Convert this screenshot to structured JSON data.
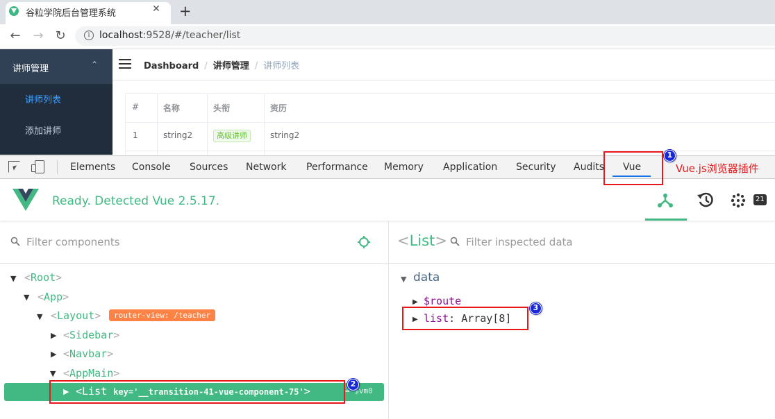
{
  "browser": {
    "tab_title": "谷粒学院后台管理系统",
    "tab_close": "✕",
    "new_tab": "+",
    "back": "←",
    "forward": "→",
    "reload": "↻",
    "url_host": "localhost",
    "url_rest": ":9528/#/teacher/list",
    "info_glyph": "i"
  },
  "app": {
    "sidebar": {
      "group_label": "讲师管理",
      "chevron": "⌃",
      "items": [
        {
          "label": "讲师列表",
          "active": true
        },
        {
          "label": "添加讲师",
          "active": false
        }
      ]
    },
    "breadcrumb": [
      "Dashboard",
      "讲师管理",
      "讲师列表"
    ],
    "breadcrumb_sep": "/",
    "table": {
      "headers": [
        "#",
        "名称",
        "头衔",
        "资历"
      ],
      "rows": [
        {
          "index": "1",
          "name": "string2",
          "title": "高级讲师",
          "resume": "string2"
        }
      ]
    }
  },
  "devtools": {
    "tabs": [
      "Elements",
      "Console",
      "Sources",
      "Network",
      "Performance",
      "Memory",
      "Application",
      "Security",
      "Audits",
      "Vue"
    ],
    "active_tab": "Vue",
    "status": "Ready. Detected Vue 2.5.17.",
    "event_badge": "21",
    "filter_components_placeholder": "Filter components",
    "filter_data_placeholder": "Filter inspected data",
    "inspected_component": "List",
    "tree": [
      {
        "name": "Root",
        "arrow": "▼"
      },
      {
        "name": "App",
        "arrow": "▼"
      },
      {
        "name": "Layout",
        "arrow": "▼",
        "badge": "router-view: /teacher"
      },
      {
        "name": "Sidebar",
        "arrow": "▶"
      },
      {
        "name": "Navbar",
        "arrow": "▶"
      },
      {
        "name": "AppMain",
        "arrow": "▼"
      }
    ],
    "selected": {
      "arrow": "▶",
      "name": "List",
      "key_attr": "key='__transition-41-vue-component-75'",
      "vm": "= $vm0"
    },
    "data_section": "data",
    "data_props": [
      {
        "key": "$route",
        "value": ""
      },
      {
        "key": "list",
        "value": "Array[8]"
      }
    ]
  },
  "annotations": {
    "note": "Vue.js浏览器插件",
    "markers": [
      "1",
      "2",
      "3"
    ],
    "color": "#e8171b"
  },
  "colors": {
    "vue_green": "#42b983",
    "sidebar_bg": "#304156",
    "router_badge": "#ff8344",
    "marker_blue": "#1928d6"
  }
}
